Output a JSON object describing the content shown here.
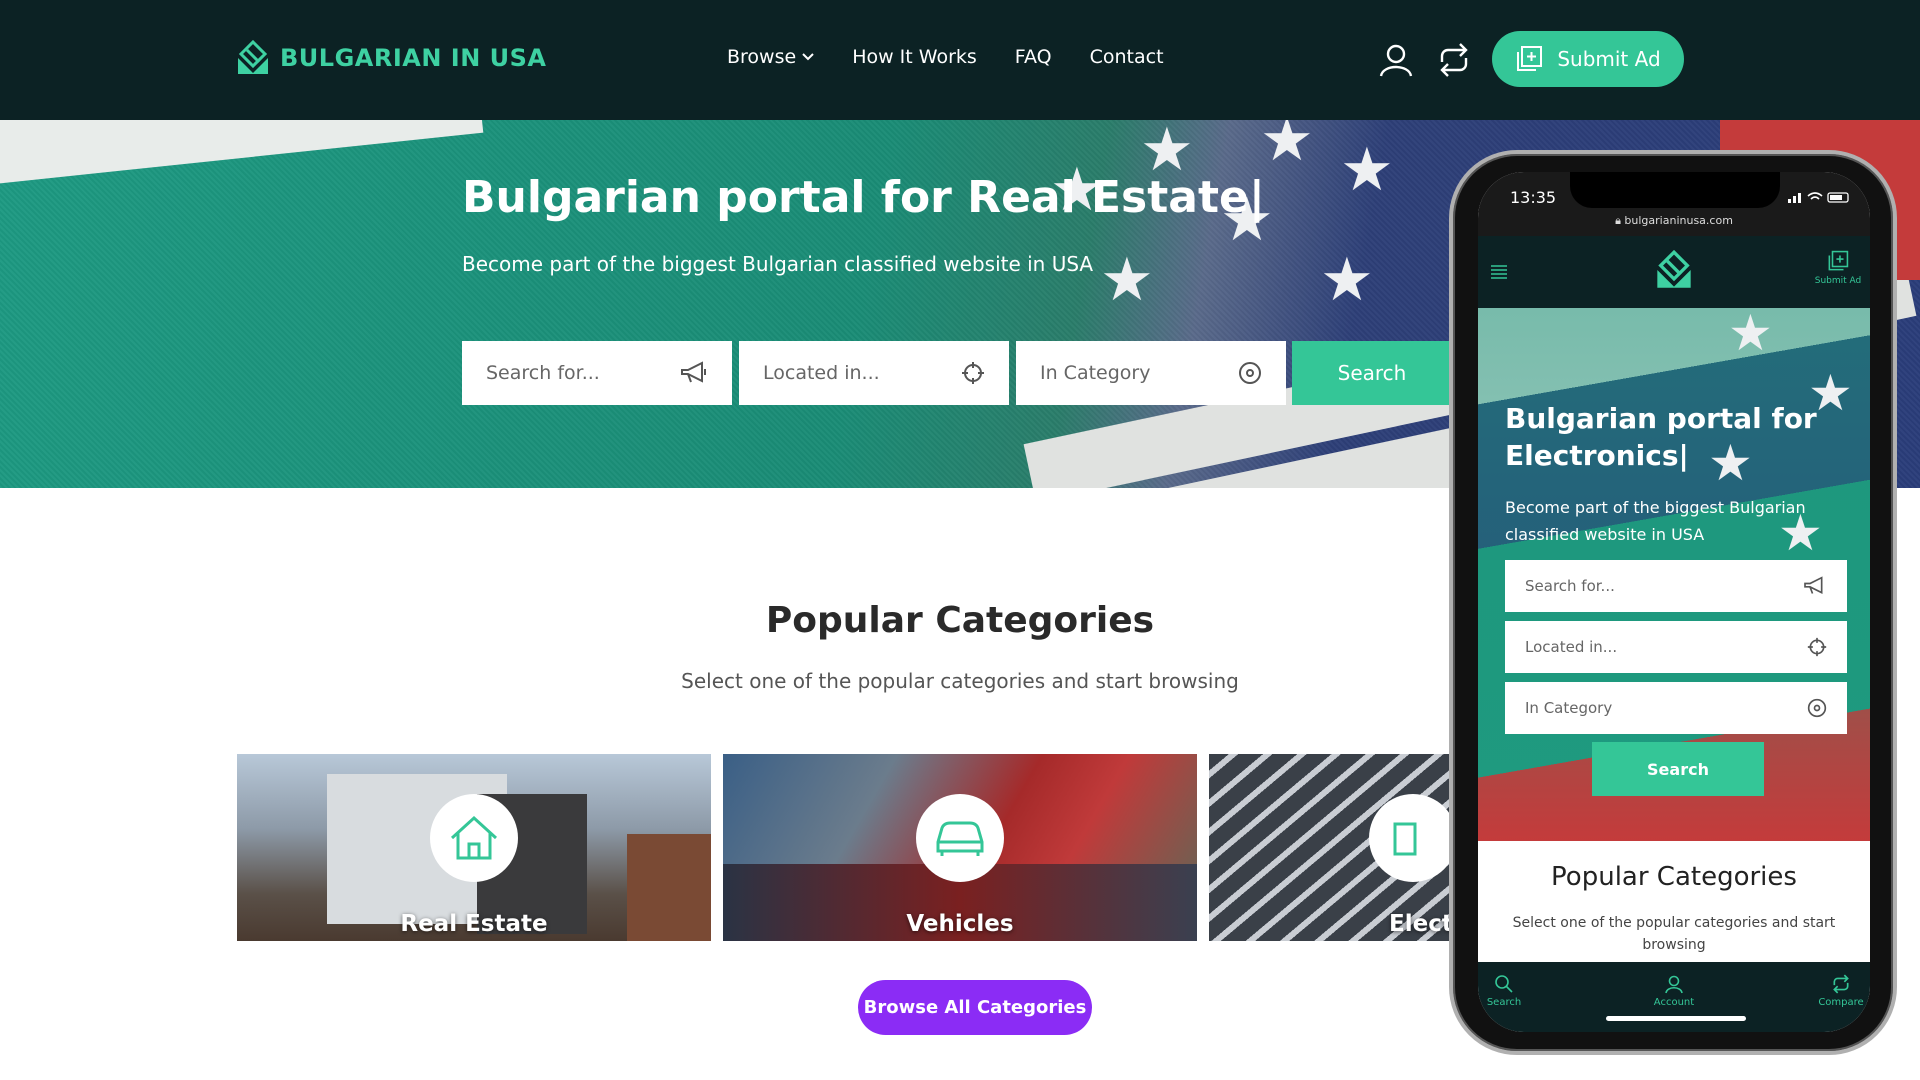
{
  "header": {
    "logo_text": "BULGARIAN IN USA",
    "nav": [
      "Browse",
      "How It Works",
      "FAQ",
      "Contact"
    ],
    "submit_label": "Submit Ad"
  },
  "hero": {
    "title": "Bulgarian portal for Real Estate|",
    "subtitle": "Become part of the biggest Bulgarian classified website in USA",
    "search_placeholder": "Search for...",
    "location_placeholder": "Located in...",
    "category_placeholder": "In Category",
    "search_button": "Search"
  },
  "categories": {
    "title": "Popular Categories",
    "subtitle": "Select one of the popular categories and start browsing",
    "items": [
      "Real Estate",
      "Vehicles",
      "Electr"
    ],
    "browse_all": "Browse All Categories"
  },
  "phone": {
    "time": "13:35",
    "url": "bulgarianinusa.com",
    "submit_label": "Submit Ad",
    "title": "Bulgarian portal for Electronics|",
    "subtitle": "Become part of the biggest Bulgarian classified website in USA",
    "search_placeholder": "Search for...",
    "location_placeholder": "Located in...",
    "category_placeholder": "In Category",
    "search_button": "Search",
    "section_title": "Popular Categories",
    "section_subtitle": "Select one of the popular categories and start browsing",
    "tabs": [
      "Search",
      "Account",
      "Compare"
    ]
  },
  "colors": {
    "header_bg": "#0c2224",
    "accent": "#34c697",
    "browse_all": "#8b2cf5"
  }
}
